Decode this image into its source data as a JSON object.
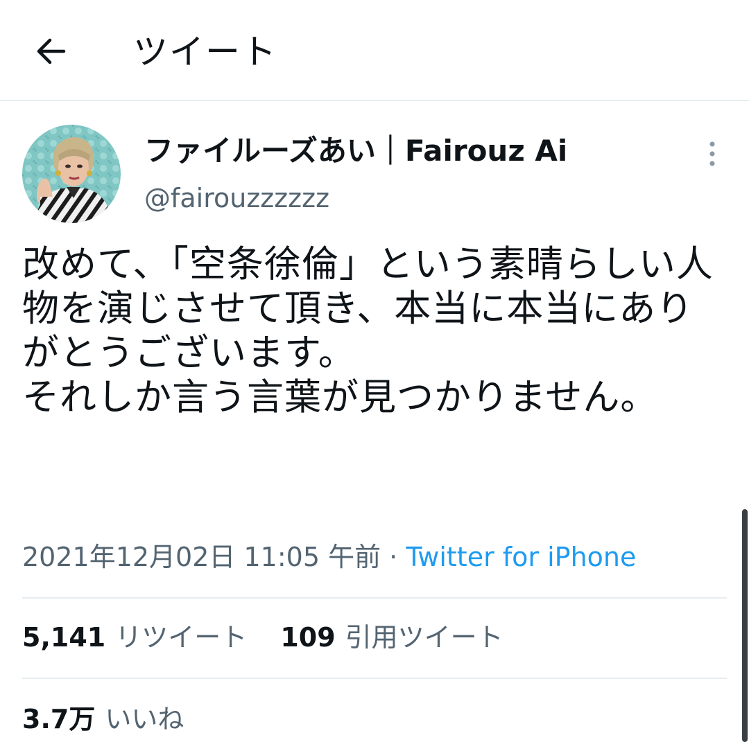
{
  "header": {
    "title": "ツイート",
    "back_icon": "arrow-left-icon"
  },
  "author": {
    "display_name": "ファイルーズあい｜Fairouz Ai",
    "handle": "@fairouzzzzzz",
    "avatar_icon": "profile-photo"
  },
  "tweet": {
    "text": "改めて、「空条徐倫」という素晴らしい人物を演じさせて頂き、本当に本当にありがとうございます。\nそれしか言う言葉が見つかりません。",
    "timestamp": "2021年12月02日 11:05 午前",
    "separator": " · ",
    "source": "Twitter for iPhone"
  },
  "stats": {
    "retweets": {
      "count": "5,141",
      "label": "リツイート"
    },
    "quotes": {
      "count": "109",
      "label": "引用ツイート"
    },
    "likes": {
      "count": "3.7万",
      "label": "いいね"
    }
  },
  "colors": {
    "text": "#0f1419",
    "secondary": "#536471",
    "link": "#1d9bf0",
    "divider": "#e6ecf0"
  }
}
